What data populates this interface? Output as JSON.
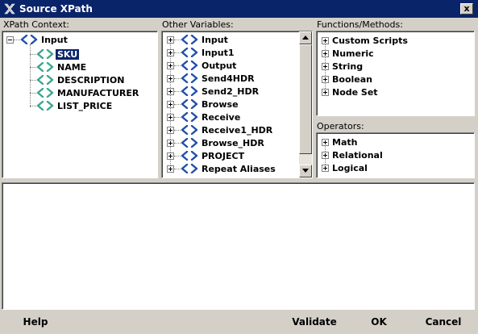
{
  "window": {
    "title": "Source XPath",
    "app_icon": "x-logo-icon",
    "close_label": "x"
  },
  "xpath_context": {
    "label": "XPath Context:",
    "root": "Input",
    "children": [
      "SKU",
      "NAME",
      "DESCRIPTION",
      "MANUFACTURER",
      "LIST_PRICE"
    ],
    "selected": "SKU"
  },
  "other_variables": {
    "label": "Other Variables:",
    "items": [
      "Input",
      "Input1",
      "Output",
      "Send4HDR",
      "Send2_HDR",
      "Browse",
      "Receive",
      "Receive1_HDR",
      "Browse_HDR",
      "PROJECT",
      "Repeat Aliases"
    ]
  },
  "functions": {
    "label": "Functions/Methods:",
    "items": [
      "Custom Scripts",
      "Numeric",
      "String",
      "Boolean",
      "Node Set"
    ]
  },
  "operators": {
    "label": "Operators:",
    "items": [
      "Math",
      "Relational",
      "Logical"
    ]
  },
  "expression": {
    "value": ""
  },
  "buttons": {
    "help": "Help",
    "validate": "Validate",
    "ok": "OK",
    "cancel": "Cancel"
  },
  "colors": {
    "titlebar": "#0a246a",
    "tag_icon_blue": "#1f4fa8",
    "tag_icon_teal": "#3aa58f"
  }
}
